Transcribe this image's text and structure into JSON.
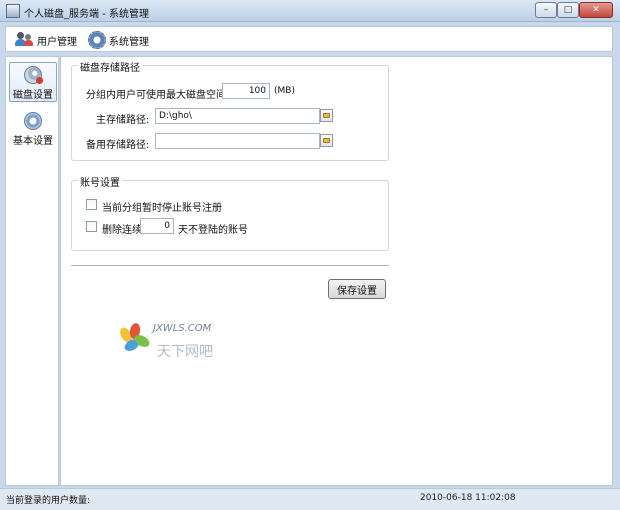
{
  "window": {
    "title": "个人磁盘_服务端 - 系统管理"
  },
  "menu": {
    "items": [
      {
        "label": "用户管理",
        "icon": "users-icon"
      },
      {
        "label": "系统管理",
        "icon": "gear-icon"
      }
    ]
  },
  "sidebar": {
    "items": [
      {
        "label": "磁盘设置",
        "icon": "disk-settings-icon"
      },
      {
        "label": "基本设置",
        "icon": "basic-settings-icon"
      }
    ]
  },
  "storage": {
    "title": "磁盘存储路径",
    "max_space_label": "分组内用户可使用最大磁盘空间",
    "max_space_value": "100",
    "max_space_unit": "(MB)",
    "main_path_label": "主存储路径:",
    "main_path_value": "D:\\gho\\",
    "backup_path_label": "备用存储路径:",
    "backup_path_value": ""
  },
  "account": {
    "title": "账号设置",
    "stop_register_label": "当前分组暂时停止账号注册",
    "delete_prefix": "删除连续",
    "delete_days": "0",
    "delete_suffix": "天不登陆的账号"
  },
  "buttons": {
    "save": "保存设置"
  },
  "status": {
    "users_label": "当前登录的用户数量:",
    "datetime": "2010-06-18 11:02:08"
  },
  "watermark": {
    "site": "JXWLS.COM",
    "name": "天下网吧"
  },
  "colors": {
    "accent": "#3a86c9",
    "frame": "#c9d8ea"
  }
}
